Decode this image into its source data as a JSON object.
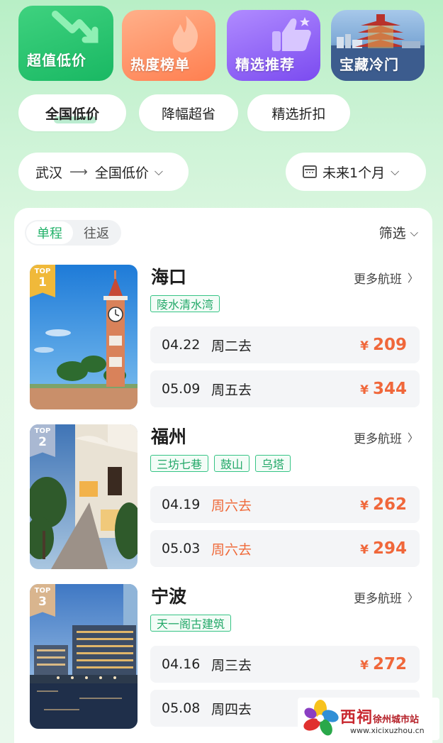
{
  "categories": [
    {
      "label": "超值低价",
      "icon": "arrow-down-icon"
    },
    {
      "label": "热度榜单",
      "icon": "flame-icon"
    },
    {
      "label": "精选推荐",
      "icon": "thumbs-up-icon"
    },
    {
      "label": "宝藏冷门",
      "icon": "pagoda-image"
    }
  ],
  "chips": [
    "全国低价",
    "降幅超省",
    "精选折扣"
  ],
  "route": {
    "from": "武汉",
    "to": "全国低价"
  },
  "date_filter": {
    "label": "未来1个月"
  },
  "trip_type": {
    "one_way": "单程",
    "round_trip": "往返"
  },
  "filter_label": "筛选",
  "colors": {
    "accent_green": "#23b26a",
    "price_orange": "#f0673a",
    "weekend_orange": "#ef6a3a"
  },
  "destinations": [
    {
      "rank_top": "TOP",
      "rank": "1",
      "city": "海口",
      "more": "更多航班",
      "tags": [
        "陵水清水湾"
      ],
      "fares": [
        {
          "date": "04.22",
          "day": "周二去",
          "price": "209",
          "yen": "¥"
        },
        {
          "date": "05.09",
          "day": "周五去",
          "price": "344",
          "yen": "¥"
        }
      ]
    },
    {
      "rank_top": "TOP",
      "rank": "2",
      "city": "福州",
      "more": "更多航班",
      "tags": [
        "三坊七巷",
        "鼓山",
        "乌塔"
      ],
      "fares": [
        {
          "date": "04.19",
          "day": "周六去",
          "price": "262",
          "yen": "¥"
        },
        {
          "date": "05.03",
          "day": "周六去",
          "price": "294",
          "yen": "¥"
        }
      ]
    },
    {
      "rank_top": "TOP",
      "rank": "3",
      "city": "宁波",
      "more": "更多航班",
      "tags": [
        "天一阁古建筑"
      ],
      "fares": [
        {
          "date": "04.16",
          "day": "周三去",
          "price": "272",
          "yen": "¥"
        },
        {
          "date": "05.08",
          "day": "周四去",
          "price": "",
          "yen": ""
        }
      ]
    }
  ],
  "watermark": {
    "brand": "西祠",
    "sub": "徐州城市站",
    "url": "www.xicixuzhou.cn"
  }
}
